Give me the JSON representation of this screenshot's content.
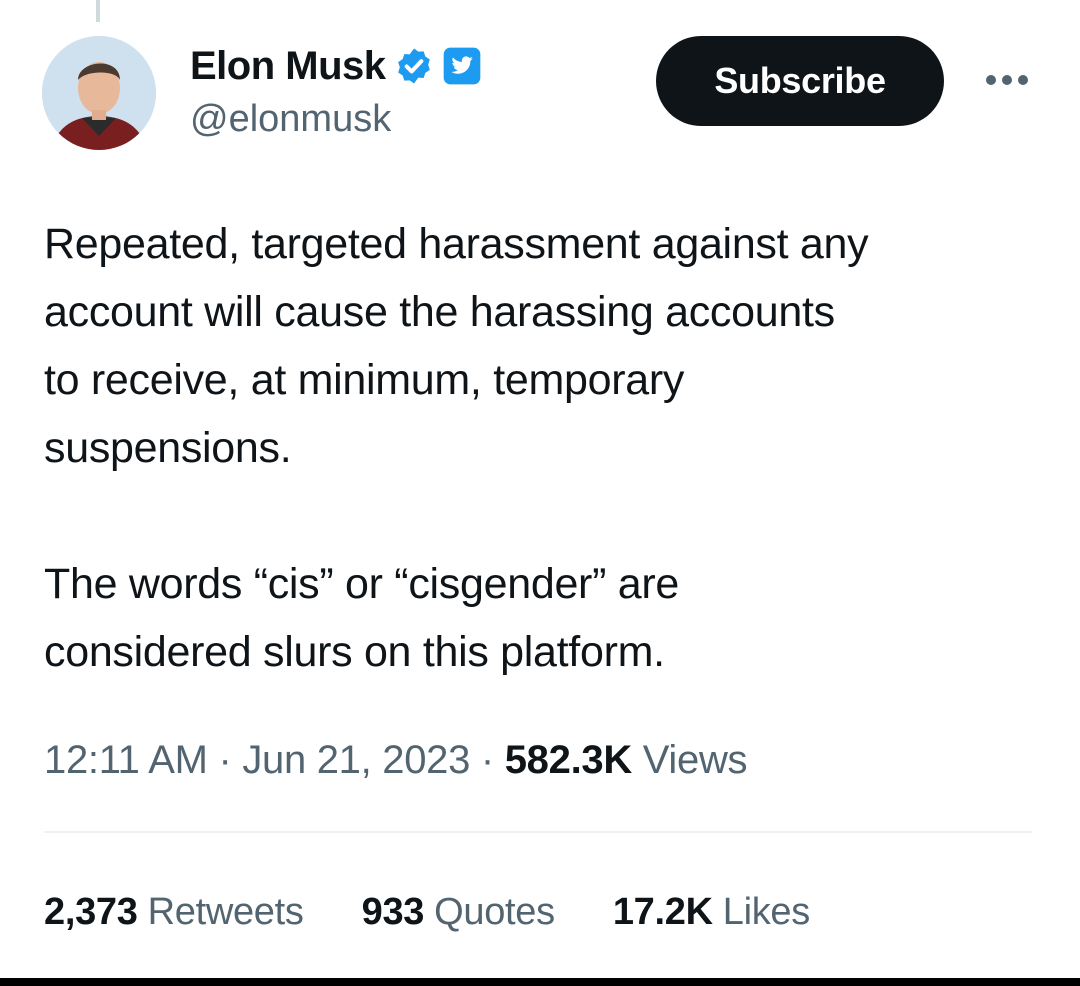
{
  "author": {
    "display_name": "Elon Musk",
    "handle": "@elonmusk",
    "verified_color": "#1d9bf0"
  },
  "actions": {
    "subscribe_label": "Subscribe",
    "more_icon": "more-horizontal-icon"
  },
  "tweet": {
    "paragraph_1": "Repeated, targeted harassment against any\naccount will cause the harassing accounts\nto receive, at minimum, temporary\nsuspensions.",
    "paragraph_2": "The words “cis” or “cisgender” are\nconsidered slurs on this platform."
  },
  "meta": {
    "time": "12:11 AM",
    "separator": "·",
    "date": "Jun 21, 2023",
    "views_count": "582.3K",
    "views_label": "Views"
  },
  "stats": [
    {
      "count": "2,373",
      "label": "Retweets"
    },
    {
      "count": "933",
      "label": "Quotes"
    },
    {
      "count": "17.2K",
      "label": "Likes"
    }
  ],
  "colors": {
    "text_primary": "#0f1419",
    "text_secondary": "#536471",
    "button_bg": "#0f1419",
    "accent": "#1d9bf0"
  }
}
